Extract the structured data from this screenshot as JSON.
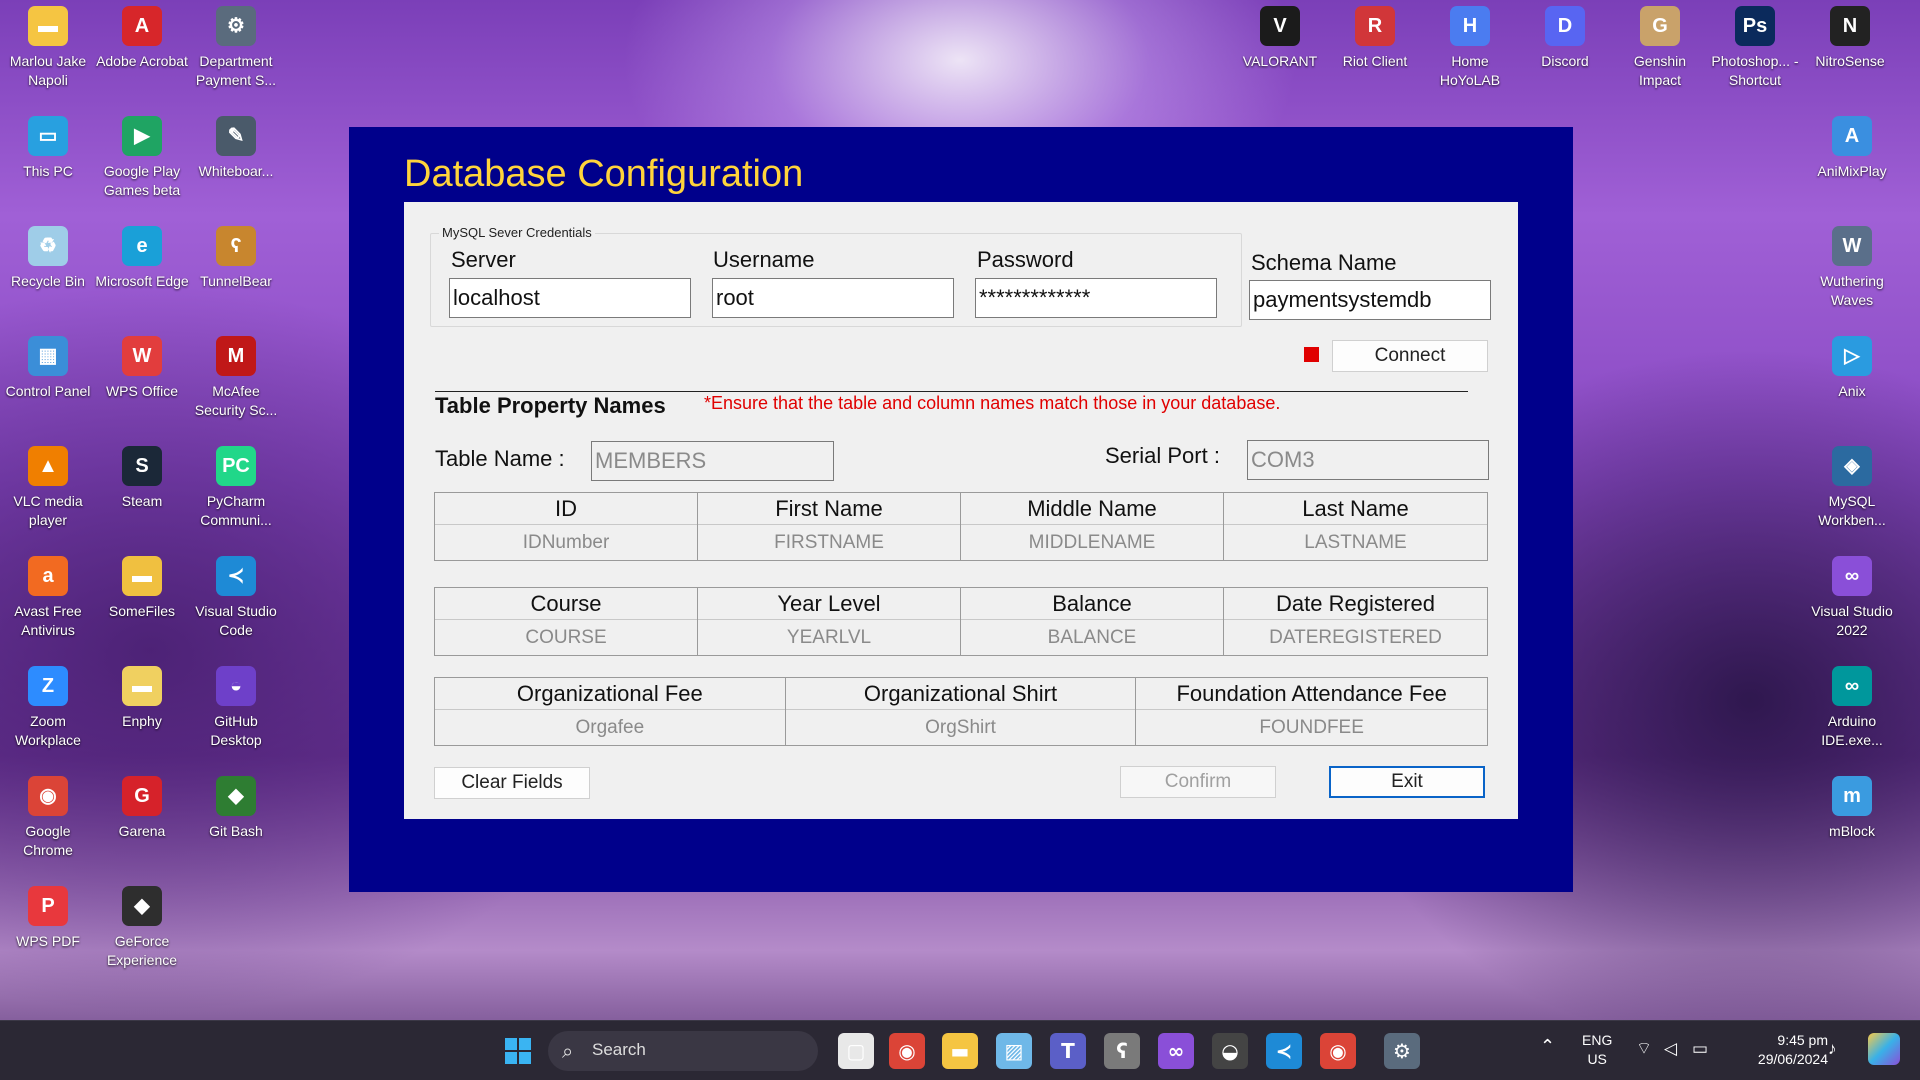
{
  "desktop": {
    "left_column_1": [
      {
        "label": "Marlou Jake Napoli",
        "icon": "folder-icon",
        "color": "#f5c542",
        "glyph": "▬"
      },
      {
        "label": "This PC",
        "icon": "monitor-icon",
        "color": "#28a0e0",
        "glyph": "▭"
      },
      {
        "label": "Recycle Bin",
        "icon": "recycle-bin-icon",
        "color": "#9fcde8",
        "glyph": "♻"
      },
      {
        "label": "Control Panel",
        "icon": "control-panel-icon",
        "color": "#3b8ed8",
        "glyph": "▦"
      },
      {
        "label": "VLC media player",
        "icon": "vlc-icon",
        "color": "#f07f00",
        "glyph": "▲"
      },
      {
        "label": "Avast Free Antivirus",
        "icon": "avast-icon",
        "color": "#f26a21",
        "glyph": "a"
      },
      {
        "label": "Zoom Workplace",
        "icon": "zoom-icon",
        "color": "#2d8cff",
        "glyph": "Z"
      },
      {
        "label": "Google Chrome",
        "icon": "chrome-icon",
        "color": "#db4437",
        "glyph": "◉"
      },
      {
        "label": "WPS PDF",
        "icon": "wps-pdf-icon",
        "color": "#e8383d",
        "glyph": "P"
      }
    ],
    "left_column_2": [
      {
        "label": "Adobe Acrobat",
        "icon": "acrobat-icon",
        "color": "#d7262a",
        "glyph": "A"
      },
      {
        "label": "Google Play Games beta",
        "icon": "play-games-icon",
        "color": "#1fa463",
        "glyph": "▶"
      },
      {
        "label": "Microsoft Edge",
        "icon": "edge-icon",
        "color": "#1aa0d8",
        "glyph": "e"
      },
      {
        "label": "WPS Office",
        "icon": "wps-office-icon",
        "color": "#e23d3d",
        "glyph": "W"
      },
      {
        "label": "Steam",
        "icon": "steam-icon",
        "color": "#1b2838",
        "glyph": "S"
      },
      {
        "label": "SomeFiles",
        "icon": "folder-icon",
        "color": "#f0c040",
        "glyph": "▬"
      },
      {
        "label": "Enphy",
        "icon": "folder-icon",
        "color": "#f0d060",
        "glyph": "▬"
      },
      {
        "label": "Garena",
        "icon": "garena-icon",
        "color": "#d6222a",
        "glyph": "G"
      },
      {
        "label": "GeForce Experience",
        "icon": "geforce-icon",
        "color": "#2e2e2e",
        "glyph": "◆"
      }
    ],
    "left_column_3": [
      {
        "label": "Department Payment S...",
        "icon": "app-shortcut-icon",
        "color": "#5a6b7d",
        "glyph": "⚙"
      },
      {
        "label": "Whiteboar...",
        "icon": "whiteboard-icon",
        "color": "#4a5a6a",
        "glyph": "✎"
      },
      {
        "label": "TunnelBear",
        "icon": "tunnelbear-icon",
        "color": "#c8862e",
        "glyph": "ʕ"
      },
      {
        "label": "McAfee Security Sc...",
        "icon": "mcafee-icon",
        "color": "#c01818",
        "glyph": "M"
      },
      {
        "label": "PyCharm Communi...",
        "icon": "pycharm-icon",
        "color": "#21d789",
        "glyph": "PC"
      },
      {
        "label": "Visual Studio Code",
        "icon": "vscode-icon",
        "color": "#1e8ad6",
        "glyph": "≺"
      },
      {
        "label": "GitHub Desktop",
        "icon": "github-desktop-icon",
        "color": "#6e40c9",
        "glyph": "◒"
      },
      {
        "label": "Git Bash",
        "icon": "git-bash-icon",
        "color": "#2e7d32",
        "glyph": "◆"
      }
    ],
    "right_top_row": [
      {
        "label": "VALORANT",
        "icon": "valorant-icon",
        "color": "#1b1b1b",
        "glyph": "V"
      },
      {
        "label": "Riot Client",
        "icon": "riot-client-icon",
        "color": "#d13639",
        "glyph": "R"
      },
      {
        "label": "Home HoYoLAB",
        "icon": "hoyolab-icon",
        "color": "#4b7cf0",
        "glyph": "H"
      },
      {
        "label": "Discord",
        "icon": "discord-icon",
        "color": "#5865f2",
        "glyph": "D"
      },
      {
        "label": "Genshin Impact",
        "icon": "genshin-icon",
        "color": "#c9a26a",
        "glyph": "G"
      },
      {
        "label": "Photoshop... - Shortcut",
        "icon": "photoshop-icon",
        "color": "#0b2a5c",
        "glyph": "Ps"
      },
      {
        "label": "NitroSense",
        "icon": "nitrosense-icon",
        "color": "#222222",
        "glyph": "N"
      }
    ],
    "right_column": [
      {
        "label": "AniMixPlay",
        "icon": "animixplay-icon",
        "color": "#3a8fe0",
        "glyph": "A"
      },
      {
        "label": "Wuthering Waves",
        "icon": "wuthering-waves-icon",
        "color": "#5a6f8a",
        "glyph": "W"
      },
      {
        "label": "Anix",
        "icon": "anix-icon",
        "color": "#2a9be0",
        "glyph": "▷"
      },
      {
        "label": "MySQL Workben...",
        "icon": "mysql-workbench-icon",
        "color": "#2b6aa0",
        "glyph": "◈"
      },
      {
        "label": "Visual Studio 2022",
        "icon": "visual-studio-icon",
        "color": "#8a4fd8",
        "glyph": "∞"
      },
      {
        "label": "Arduino IDE.exe...",
        "icon": "arduino-icon",
        "color": "#00979c",
        "glyph": "∞"
      },
      {
        "label": "mBlock",
        "icon": "mblock-icon",
        "color": "#3a9be0",
        "glyph": "m"
      }
    ]
  },
  "app": {
    "title": "Database Configuration",
    "credentials": {
      "group_label": "MySQL Sever Credentials",
      "server_label": "Server",
      "server_value": "localhost",
      "username_label": "Username",
      "username_value": "root",
      "password_label": "Password",
      "password_value": "*************"
    },
    "schema_label": "Schema Name",
    "schema_value": "paymentsystemdb",
    "connect_label": "Connect",
    "connection_status_color": "#e00000",
    "table_section_title": "Table Property Names",
    "warning": "*Ensure that the table and column names match those in your database.",
    "table_name_label": "Table Name :",
    "table_name_value": "MEMBERS",
    "serial_port_label": "Serial Port :",
    "serial_port_value": "COM3",
    "mapping_row1": [
      {
        "header": "ID",
        "value": "IDNumber"
      },
      {
        "header": "First Name",
        "value": "FIRSTNAME"
      },
      {
        "header": "Middle Name",
        "value": "MIDDLENAME"
      },
      {
        "header": "Last Name",
        "value": "LASTNAME"
      }
    ],
    "mapping_row2": [
      {
        "header": "Course",
        "value": "COURSE"
      },
      {
        "header": "Year Level",
        "value": "YEARLVL"
      },
      {
        "header": "Balance",
        "value": "BALANCE"
      },
      {
        "header": "Date Registered",
        "value": "DATEREGISTERED"
      }
    ],
    "mapping_row3": [
      {
        "header": "Organizational Fee",
        "value": "Orgafee"
      },
      {
        "header": "Organizational Shirt",
        "value": "OrgShirt"
      },
      {
        "header": "Foundation Attendance Fee",
        "value": "FOUNDFEE"
      }
    ],
    "clear_label": "Clear Fields",
    "confirm_label": "Confirm",
    "exit_label": "Exit"
  },
  "taskbar": {
    "search_placeholder": "Search",
    "language": "ENG",
    "region": "US",
    "time": "9:45 pm",
    "date": "29/06/2024",
    "pinned": [
      {
        "icon": "task-view-icon",
        "color": "#e8e8e8",
        "glyph": "▢"
      },
      {
        "icon": "chrome-icon",
        "color": "#db4437",
        "glyph": "◉"
      },
      {
        "icon": "file-explorer-icon",
        "color": "#f5c542",
        "glyph": "▬"
      },
      {
        "icon": "photos-icon",
        "color": "#6fb8e8",
        "glyph": "▨"
      },
      {
        "icon": "teams-icon",
        "color": "#5b5fc7",
        "glyph": "T"
      },
      {
        "icon": "tunnelbear-icon",
        "color": "#7a7a7a",
        "glyph": "ʕ"
      },
      {
        "icon": "visual-studio-icon",
        "color": "#8a4fd8",
        "glyph": "∞"
      },
      {
        "icon": "github-icon",
        "color": "#444444",
        "glyph": "◒"
      },
      {
        "icon": "vscode-icon",
        "color": "#1e8ad6",
        "glyph": "≺"
      },
      {
        "icon": "chrome-profile-icon",
        "color": "#db4437",
        "glyph": "◉"
      },
      {
        "icon": "app-shortcut-icon",
        "color": "#5a6b7d",
        "glyph": "⚙"
      }
    ]
  }
}
